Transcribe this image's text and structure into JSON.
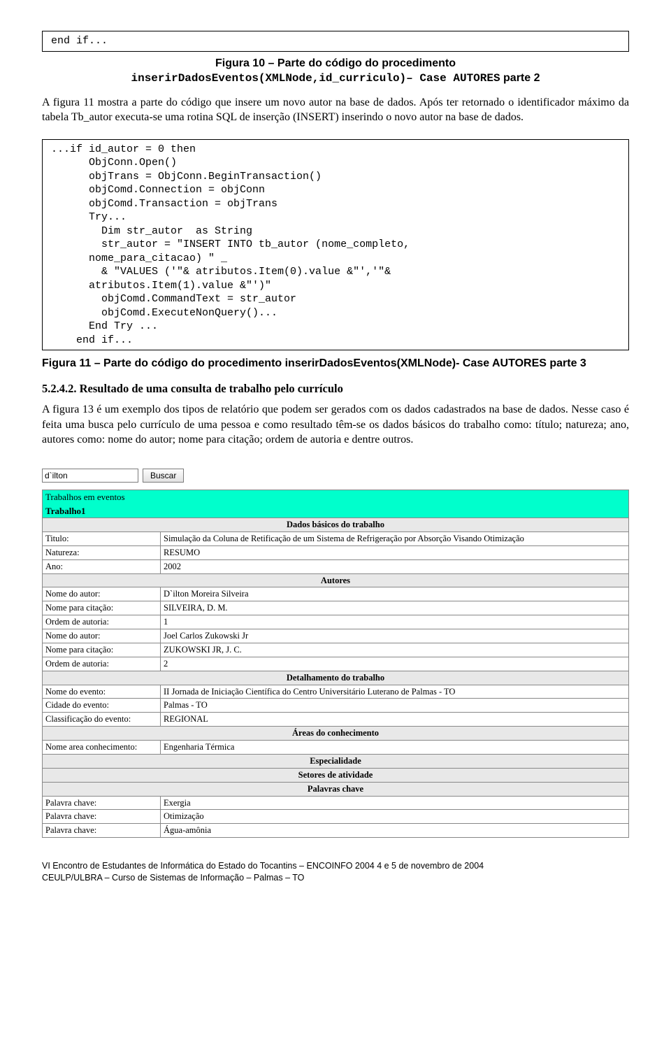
{
  "code_top": "end if...",
  "figure10": {
    "line1": "Figura 10 – Parte do código do procedimento",
    "mono_part": "inserirDadosEventos(XMLNode,id_curriculo)– Case AUTORES",
    "tail": " parte 2"
  },
  "para1": "A figura 11 mostra a parte do código que insere um novo autor na base de dados. Após ter retornado o identificador máximo da tabela Tb_autor executa-se uma rotina SQL de inserção (INSERT) inserindo o novo autor na base de dados.",
  "code_block": "...if id_autor = 0 then\n      ObjConn.Open()\n      objTrans = ObjConn.BeginTransaction()\n      objComd.Connection = objConn\n      objComd.Transaction = objTrans\n      Try...\n        Dim str_autor  as String\n        str_autor = \"INSERT INTO tb_autor (nome_completo,\n      nome_para_citacao) \" _\n        & \"VALUES ('\"& atributos.Item(0).value &\"','\"&\n      atributos.Item(1).value &\"')\"\n        objComd.CommandText = str_autor\n        objComd.ExecuteNonQuery()...\n      End Try ...\n    end if...",
  "figure11": "Figura 11 – Parte do código do procedimento inserirDadosEventos(XMLNode)- Case AUTORES parte 3",
  "section_heading": "5.2.4.2. Resultado de uma consulta de trabalho pelo currículo",
  "para2": "A figura 13 é um exemplo dos tipos de relatório que podem ser gerados com os dados cadastrados na base de dados. Nesse caso é feita uma busca pelo currículo de uma pessoa e como resultado têm-se os dados básicos do trabalho como: título; natureza; ano, autores como: nome do autor; nome para citação; ordem de autoria e dentre outros.",
  "search": {
    "value": "d`ilton",
    "button": "Buscar"
  },
  "report": {
    "band_trabalhos": "Trabalhos em eventos",
    "band_trabalho1": "Trabalho1",
    "hdr_dados_basicos": "Dados básicos do trabalho",
    "rows_basicos": [
      {
        "label": "Titulo:",
        "value": "Simulação da Coluna de Retificação de um Sistema de Refrigeração por Absorção Visando Otimização"
      },
      {
        "label": "Natureza:",
        "value": "RESUMO"
      },
      {
        "label": "Ano:",
        "value": "2002"
      }
    ],
    "hdr_autores": "Autores",
    "rows_autores": [
      {
        "label": "Nome do autor:",
        "value": "D`ilton Moreira Silveira"
      },
      {
        "label": "Nome para citação:",
        "value": "SILVEIRA, D. M."
      },
      {
        "label": "Ordem de autoria:",
        "value": "1"
      },
      {
        "label": "Nome do autor:",
        "value": "Joel Carlos Zukowski Jr"
      },
      {
        "label": "Nome para citação:",
        "value": "ZUKOWSKI JR, J. C."
      },
      {
        "label": "Ordem de autoria:",
        "value": "2"
      }
    ],
    "hdr_detalhamento": "Detalhamento do trabalho",
    "rows_detalhamento": [
      {
        "label": "Nome do evento:",
        "value": "II Jornada de Iniciação Científica do Centro Universitário Luterano de Palmas - TO"
      },
      {
        "label": "Cidade do evento:",
        "value": "Palmas - TO"
      },
      {
        "label": "Classificação do evento:",
        "value": "REGIONAL"
      }
    ],
    "hdr_areas": "Áreas do conhecimento",
    "rows_areas": [
      {
        "label": "Nome area conhecimento:",
        "value": "Engenharia Térmica"
      }
    ],
    "hdr_especialidade": "Especialidade",
    "hdr_setores": "Setores de atividade",
    "hdr_palavras": "Palavras chave",
    "rows_palavras": [
      {
        "label": "Palavra chave:",
        "value": "Exergia"
      },
      {
        "label": "Palavra chave:",
        "value": "Otimização"
      },
      {
        "label": "Palavra chave:",
        "value": "Água-amônia"
      }
    ]
  },
  "footer": {
    "line1": "VI Encontro de Estudantes de Informática do Estado do Tocantins – ENCOINFO 2004   4 e 5 de novembro de 2004",
    "line2": "CEULP/ULBRA – Curso de Sistemas de Informação – Palmas  – TO"
  }
}
